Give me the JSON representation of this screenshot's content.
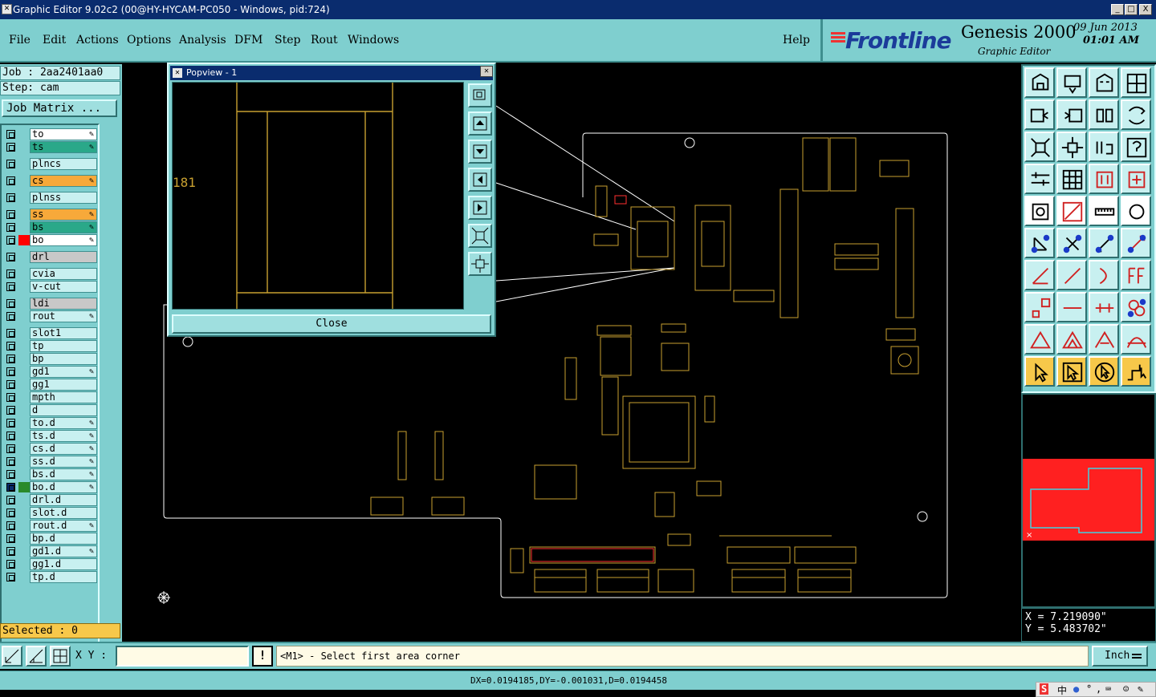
{
  "window": {
    "title": "Graphic Editor 9.02c2 (00@HY-HYCAM-PC050 - Windows, pid:724)",
    "controls": [
      "_",
      "□",
      "X"
    ]
  },
  "menu": {
    "items": [
      {
        "label": "File"
      },
      {
        "label": "Edit"
      },
      {
        "label": "Actions"
      },
      {
        "label": "Options"
      },
      {
        "label": "Analysis"
      },
      {
        "label": "DFM"
      },
      {
        "label": "Step"
      },
      {
        "label": "Rout"
      },
      {
        "label": "Windows"
      }
    ],
    "help": "Help"
  },
  "brand": {
    "logo": "Frontline",
    "product": "Genesis 2000",
    "subtitle": "Graphic Editor",
    "date": "09  Jun  2013",
    "time": "01:01  AM"
  },
  "job": {
    "job_label": "Job : 2aa2401aa0",
    "step_label": "Step: cam",
    "matrix_button": "Job Matrix ..."
  },
  "layers": [
    {
      "name": "to",
      "color": "#ffffff",
      "editable": true
    },
    {
      "name": "ts",
      "color": "#2aa889",
      "editable": true
    },
    {
      "name": "plncs",
      "color": "#c8f0f0",
      "editable": false
    },
    {
      "name": "cs",
      "color": "#f7a93a",
      "editable": true
    },
    {
      "name": "plnss",
      "color": "#c8f0f0",
      "editable": false
    },
    {
      "name": "ss",
      "color": "#f7a93a",
      "editable": true
    },
    {
      "name": "bs",
      "color": "#2aa889",
      "editable": true
    },
    {
      "name": "bo",
      "color": "#ffffff",
      "editable": true,
      "marked": "#ff0000"
    },
    {
      "name": "drl",
      "color": "#c8c8c8",
      "editable": false
    },
    {
      "name": "cvia",
      "color": "#c8f0f0",
      "editable": false
    },
    {
      "name": "v-cut",
      "color": "#c8f0f0",
      "editable": false
    },
    {
      "name": "ldi",
      "color": "#c8c8c8",
      "editable": false
    },
    {
      "name": "rout",
      "color": "#c8f0f0",
      "editable": true
    },
    {
      "name": "slot1",
      "color": "#c8f0f0",
      "editable": false
    },
    {
      "name": "tp",
      "color": "#c8f0f0",
      "editable": false
    },
    {
      "name": "bp",
      "color": "#c8f0f0",
      "editable": false
    },
    {
      "name": "gd1",
      "color": "#c8f0f0",
      "editable": true
    },
    {
      "name": "gg1",
      "color": "#c8f0f0",
      "editable": false
    },
    {
      "name": "mpth",
      "color": "#c8f0f0",
      "editable": false
    },
    {
      "name": "d",
      "color": "#c8f0f0",
      "editable": false
    },
    {
      "name": "to.d",
      "color": "#c8f0f0",
      "editable": true
    },
    {
      "name": "ts.d",
      "color": "#c8f0f0",
      "editable": true
    },
    {
      "name": "cs.d",
      "color": "#c8f0f0",
      "editable": true
    },
    {
      "name": "ss.d",
      "color": "#c8f0f0",
      "editable": true
    },
    {
      "name": "bs.d",
      "color": "#c8f0f0",
      "editable": true
    },
    {
      "name": "bo.d",
      "color": "#c8f0f0",
      "editable": true,
      "marked": "#2a8a2a",
      "active": true
    },
    {
      "name": "drl.d",
      "color": "#c8f0f0",
      "editable": false
    },
    {
      "name": "slot.d",
      "color": "#c8f0f0",
      "editable": false
    },
    {
      "name": "rout.d",
      "color": "#c8f0f0",
      "editable": true
    },
    {
      "name": "bp.d",
      "color": "#c8f0f0",
      "editable": false
    },
    {
      "name": "gd1.d",
      "color": "#c8f0f0",
      "editable": true
    },
    {
      "name": "gg1.d",
      "color": "#c8f0f0",
      "editable": false
    },
    {
      "name": "tp.d",
      "color": "#c8f0f0",
      "editable": false
    }
  ],
  "selected": "Selected : 0",
  "popview": {
    "title": "Popview - 1",
    "close_label": "Close",
    "side_label": "181"
  },
  "coords": {
    "x": "X  =  7.219090\"",
    "y": "Y  =  5.483702\""
  },
  "bottom": {
    "xy_label": "X Y :",
    "xy_value": "",
    "warn": "!",
    "prompt": "<M1> - Select first area corner",
    "unit": "Inch"
  },
  "status": {
    "delta": "DX=0.0194185,DY=-0.001031,D=0.0194458"
  },
  "tray": [
    "中",
    "°",
    ","
  ],
  "colors": {
    "panel": "#7fcfcf",
    "outline": "#ffffff",
    "pads": "#c8a030",
    "highlight": "#ff3030"
  }
}
